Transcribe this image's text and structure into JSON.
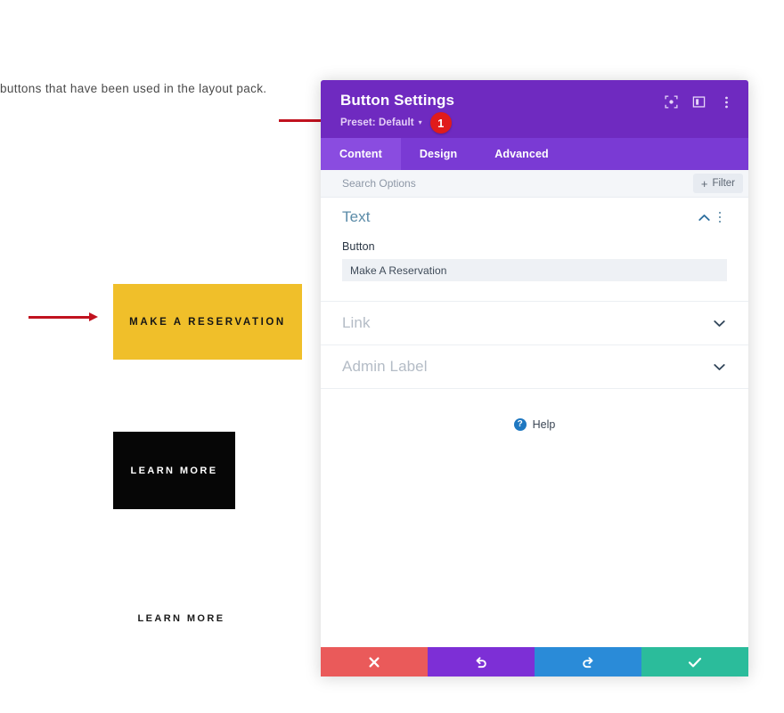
{
  "page": {
    "paragraph_text": "buttons that have been used in the layout pack.",
    "buttons": [
      {
        "label": "MAKE A RESERVATION",
        "style": "yellow-filled",
        "bg": "#f0bf2a",
        "text_color": "#161616"
      },
      {
        "label": "LEARN MORE",
        "style": "black-filled",
        "bg": "#060606",
        "text_color": "#ffffff"
      },
      {
        "label": "LEARN MORE",
        "style": "plain-text",
        "bg": "transparent",
        "text_color": "#1a1a1a"
      }
    ]
  },
  "annotations": {
    "arrow_color": "#c1121f",
    "step_badge": "1",
    "step_badge_color": "#e01b1b"
  },
  "modal": {
    "title": "Button Settings",
    "preset_label": "Preset: Default",
    "preset_caret": "▾",
    "header_color": "#6f2ac0",
    "header_icons": [
      {
        "name": "fullscreen-icon"
      },
      {
        "name": "layout-columns-icon"
      },
      {
        "name": "more-options-icon"
      }
    ],
    "tabs": [
      {
        "label": "Content",
        "active": true
      },
      {
        "label": "Design",
        "active": false
      },
      {
        "label": "Advanced",
        "active": false
      }
    ],
    "search": {
      "placeholder": "Search Options",
      "value": ""
    },
    "filter_button": {
      "label": "Filter",
      "plus": "+"
    },
    "sections": [
      {
        "title": "Text",
        "state": "expanded",
        "color": "#5b8ba8",
        "fields": [
          {
            "label": "Button",
            "value": "Make A Reservation",
            "type": "text"
          }
        ]
      },
      {
        "title": "Link",
        "state": "collapsed",
        "color": "#b4bcc6"
      },
      {
        "title": "Admin Label",
        "state": "collapsed",
        "color": "#b4bcc6"
      }
    ],
    "help": {
      "icon_label": "?",
      "label": "Help"
    },
    "footer_buttons": [
      {
        "name": "cancel",
        "icon": "close-x-icon",
        "color": "#ea5a5a"
      },
      {
        "name": "undo",
        "icon": "undo-arrow-icon",
        "color": "#7d2fd6"
      },
      {
        "name": "redo",
        "icon": "redo-arrow-icon",
        "color": "#2a8bd8"
      },
      {
        "name": "save",
        "icon": "check-mark-icon",
        "color": "#2bbc9b"
      }
    ]
  }
}
